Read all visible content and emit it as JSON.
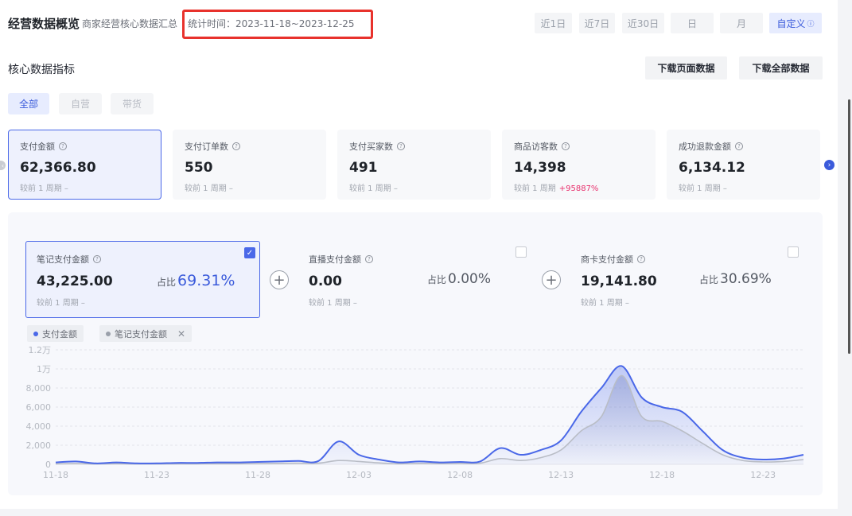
{
  "header": {
    "title": "经营数据概览",
    "subtitle": "商家经营核心数据汇总",
    "stat_time": "统计时间：2023-11-18~2023-12-25",
    "ranges": [
      {
        "label": "近1日"
      },
      {
        "label": "近7日"
      },
      {
        "label": "近30日"
      },
      {
        "label": "日"
      },
      {
        "label": "月"
      },
      {
        "label": "自定义",
        "active": true
      }
    ]
  },
  "section": {
    "title": "核心数据指标",
    "download_page": "下载页面数据",
    "download_all": "下载全部数据"
  },
  "filters": [
    {
      "label": "全部",
      "active": true
    },
    {
      "label": "自营"
    },
    {
      "label": "带货"
    }
  ],
  "kpis": [
    {
      "label": "支付金额",
      "value": "62,366.80",
      "compare": "较前 1 周期",
      "delta": "–"
    },
    {
      "label": "支付订单数",
      "value": "550",
      "compare": "较前 1 周期",
      "delta": "–"
    },
    {
      "label": "支付买家数",
      "value": "491",
      "compare": "较前 1 周期",
      "delta": "–"
    },
    {
      "label": "商品访客数",
      "value": "14,398",
      "compare": "较前 1 周期",
      "delta": "+95887%"
    },
    {
      "label": "成功退款金额",
      "value": "6,134.12",
      "compare": "较前 1 周期",
      "delta": "–"
    }
  ],
  "sub_cards": [
    {
      "label": "笔记支付金额",
      "value": "43,225.00",
      "compare": "较前 1 周期",
      "delta": "–",
      "share_label": "占比",
      "share": "69.31%"
    },
    {
      "label": "直播支付金额",
      "value": "0.00",
      "compare": "较前 1 周期",
      "delta": "–",
      "share_label": "占比",
      "share": "0.00%"
    },
    {
      "label": "商卡支付金额",
      "value": "19,141.80",
      "compare": "较前 1 周期",
      "delta": "–",
      "share_label": "占比",
      "share": "30.69%"
    }
  ],
  "legend": [
    {
      "label": "支付金额",
      "color": "#4a68e8"
    },
    {
      "label": "笔记支付金额",
      "color": "#9aa0aa",
      "removable": "✕"
    }
  ],
  "chart_data": {
    "type": "area",
    "yticks": [
      "0",
      "2,000",
      "4,000",
      "6,000",
      "8,000",
      "1万",
      "1.2万"
    ],
    "ylim": [
      0,
      12000
    ],
    "xticks": [
      "11-18",
      "11-23",
      "11-28",
      "12-03",
      "12-08",
      "12-13",
      "12-18",
      "12-23"
    ],
    "x": [
      "11-18",
      "11-19",
      "11-20",
      "11-21",
      "11-22",
      "11-23",
      "11-24",
      "11-25",
      "11-26",
      "11-27",
      "11-28",
      "11-29",
      "11-30",
      "12-01",
      "12-02",
      "12-03",
      "12-04",
      "12-05",
      "12-06",
      "12-07",
      "12-08",
      "12-09",
      "12-10",
      "12-11",
      "12-12",
      "12-13",
      "12-14",
      "12-15",
      "12-16",
      "12-17",
      "12-18",
      "12-19",
      "12-20",
      "12-21",
      "12-22",
      "12-23",
      "12-24",
      "12-25"
    ],
    "series": [
      {
        "values": [
          200,
          300,
          100,
          200,
          100,
          100,
          150,
          150,
          200,
          200,
          250,
          300,
          350,
          350,
          2400,
          1000,
          500,
          200,
          300,
          200,
          250,
          300,
          1700,
          1000,
          1500,
          2500,
          5500,
          8000,
          10300,
          7000,
          6000,
          5500,
          3500,
          1500,
          700,
          500,
          600,
          1000
        ]
      },
      {
        "values": [
          50,
          80,
          40,
          60,
          40,
          40,
          50,
          50,
          60,
          60,
          80,
          100,
          120,
          120,
          400,
          300,
          150,
          60,
          100,
          70,
          100,
          120,
          600,
          400,
          700,
          1500,
          3500,
          5000,
          9300,
          5000,
          4500,
          3500,
          2200,
          1000,
          400,
          250,
          300,
          500
        ]
      }
    ]
  }
}
